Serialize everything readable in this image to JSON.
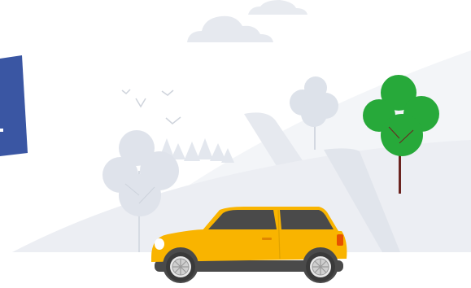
{
  "illustration": {
    "subject": "car-driving-through-hills",
    "colors": {
      "background": "#ffffff",
      "hill_light": "#f1f3f6",
      "hill_mid": "#e4e8ef",
      "road": "#dfe3ea",
      "cloud": "#e6e9ef",
      "pale_tree": "#d8dde6",
      "green_tree": "#27a93a",
      "trunk": "#6b2420",
      "car_body": "#f9b400",
      "car_window": "#4a4a4a",
      "banner": "#3a56a3"
    },
    "icons": [
      "car-icon",
      "tree-icon",
      "cloud-icon",
      "bird-icon"
    ]
  }
}
